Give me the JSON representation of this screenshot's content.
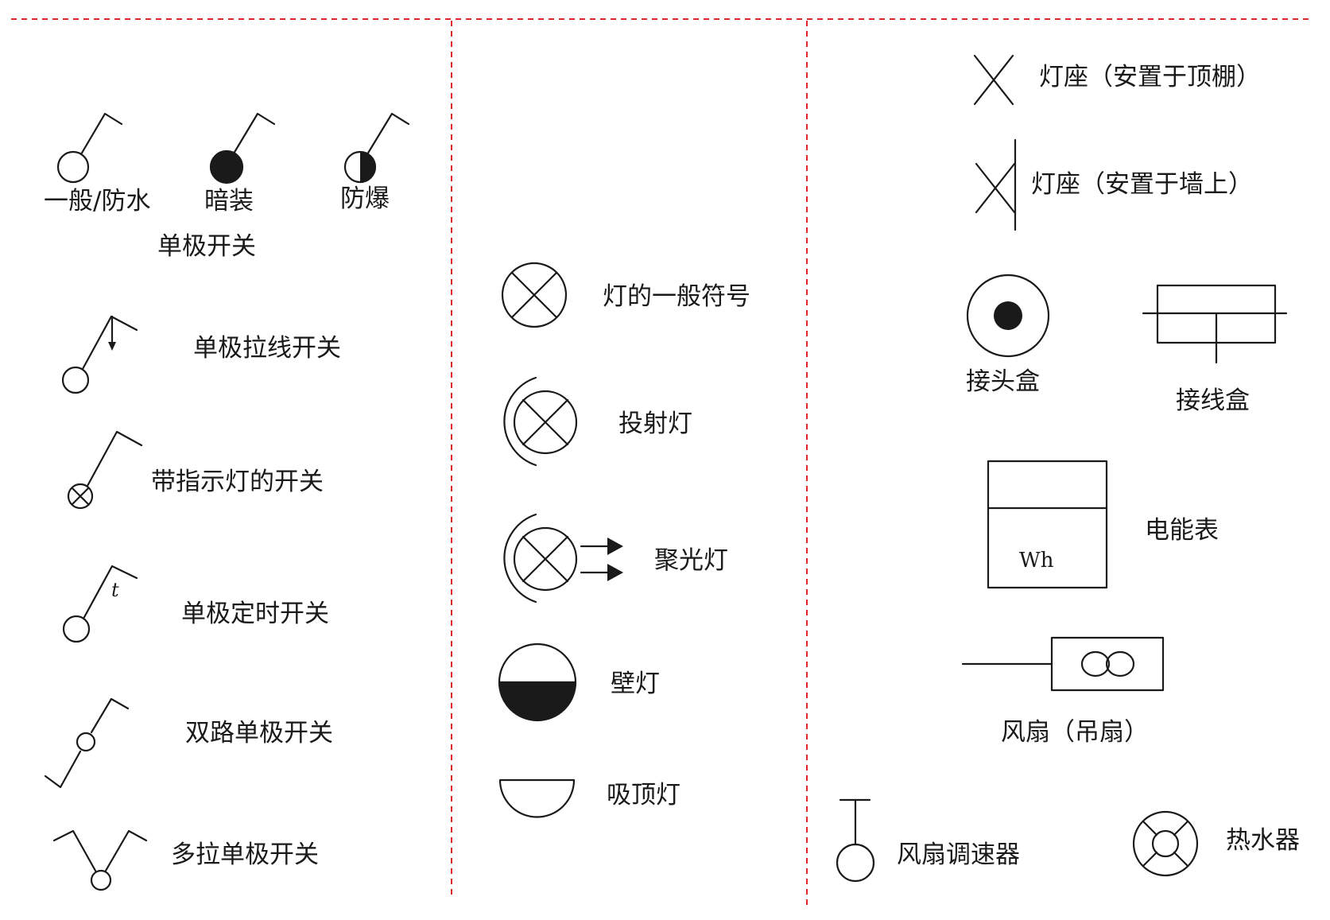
{
  "left_column": {
    "single_pole_switch": {
      "general_label": "一般/防水",
      "concealed_label": "暗装",
      "explosion_proof_label": "防爆",
      "group_label": "单极开关"
    },
    "pull_cord_switch_label": "单极拉线开关",
    "indicator_switch_label": "带指示灯的开关",
    "timer_switch": {
      "label": "单极定时开关",
      "symbol_text": "t"
    },
    "two_way_switch_label": "双路单极开关",
    "multi_pull_switch_label": "多拉单极开关"
  },
  "middle_column": {
    "lamp_general_label": "灯的一般符号",
    "projector_lamp_label": "投射灯",
    "spotlight_label": "聚光灯",
    "wall_lamp_label": "壁灯",
    "ceiling_lamp_label": "吸顶灯"
  },
  "right_column": {
    "lamp_holder_ceiling_label": "灯座（安置于顶棚）",
    "lamp_holder_wall_label": "灯座（安置于墙上）",
    "junction_box_label": "接头盒",
    "terminal_box_label": "接线盒",
    "energy_meter": {
      "label": "电能表",
      "unit_text": "Wh"
    },
    "fan": {
      "label": "风扇（吊扇）",
      "symbol_text": "∞"
    },
    "fan_speed_controller_label": "风扇调速器",
    "water_heater_label": "热水器"
  },
  "colors": {
    "divider": "#e0262b",
    "ink": "#1a1a1a",
    "background": "#ffffff"
  }
}
